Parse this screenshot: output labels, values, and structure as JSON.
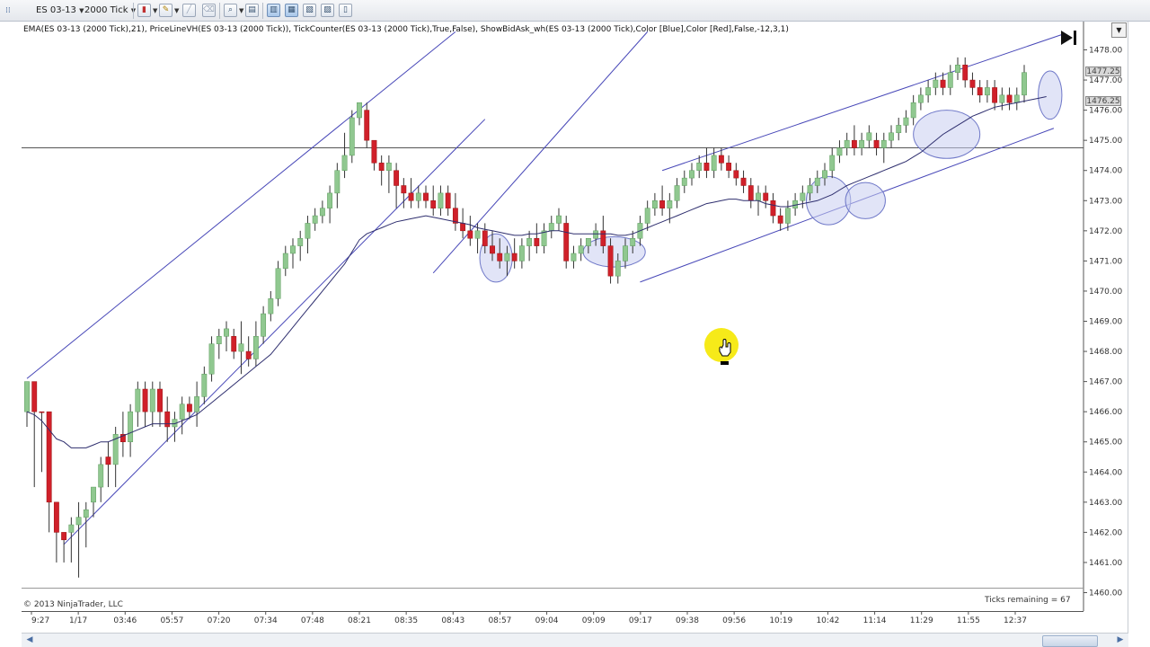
{
  "toolbar": {
    "instrument": "ES 03-13",
    "period": "2000 Tick",
    "icons": [
      "candlestick-icon",
      "pencil-icon",
      "drawing-icon",
      "zoom-icon",
      "properties-icon",
      "bar-spacing-icon",
      "data-box-icon",
      "chart-trader-icon",
      "strategy-icon",
      "dom-icon"
    ]
  },
  "indicator_text": "EMA(ES 03-13 (2000 Tick),21), PriceLineVH(ES 03-13 (2000 Tick)), TickCounter(ES 03-13 (2000 Tick),True,False), ShowBidAsk_wh(ES 03-13 (2000 Tick),Color [Blue],Color [Red],False,-12,3,1)",
  "copyright": "© 2013 NinjaTrader, LLC",
  "ticks_remaining": "Ticks remaining = 67",
  "colors": {
    "up": "#90c890",
    "down": "#d0202a",
    "wick": "#333333",
    "ema": "#2e2e6e",
    "trendline": "#4848b8",
    "ellipse_fill": "#c8cdf0",
    "ellipse_stroke": "#6f78c8",
    "cursor_highlight": "#f5e800"
  },
  "chart_data": {
    "type": "candlestick",
    "y_axis": {
      "min": 1460.0,
      "max": 1478.0,
      "ticks": [
        "1478.00",
        "1477.00",
        "1476.00",
        "1475.00",
        "1474.00",
        "1473.00",
        "1472.00",
        "1471.00",
        "1470.00",
        "1469.00",
        "1468.00",
        "1467.00",
        "1466.00",
        "1465.00",
        "1464.00",
        "1463.00",
        "1462.00",
        "1461.00",
        "1460.00"
      ]
    },
    "x_labels": [
      "9:27",
      "1/17",
      "03:46",
      "05:57",
      "07:20",
      "07:34",
      "07:48",
      "08:21",
      "08:35",
      "08:43",
      "08:57",
      "09:04",
      "09:09",
      "09:17",
      "09:38",
      "09:56",
      "10:19",
      "10:42",
      "11:14",
      "11:29",
      "11:55",
      "12:37"
    ],
    "price_labels": {
      "ask": "1477.25",
      "bid": "1476.25"
    },
    "horizontal_line": 1474.75,
    "candles": [
      [
        1466,
        1467,
        1465.5,
        1467,
        "1"
      ],
      [
        1467,
        1467,
        1463.5,
        1466,
        "0"
      ],
      [
        1466,
        1466,
        1464,
        1466,
        "0"
      ],
      [
        1466,
        1466,
        1462,
        1463,
        "0"
      ],
      [
        1463,
        1463,
        1461,
        1462,
        "0"
      ],
      [
        1462,
        1462,
        1461,
        1461.75,
        "0"
      ],
      [
        1462,
        1462.5,
        1461,
        1462.25,
        "1"
      ],
      [
        1462.25,
        1463,
        1460.5,
        1462.5,
        "1"
      ],
      [
        1462.5,
        1463,
        1461.5,
        1462.75,
        "1"
      ],
      [
        1463,
        1463.5,
        1462.5,
        1463.5,
        "1"
      ],
      [
        1463.5,
        1464.5,
        1463,
        1464.25,
        "1"
      ],
      [
        1464.5,
        1465,
        1463.5,
        1464.25,
        "0"
      ],
      [
        1464.25,
        1465.5,
        1463.5,
        1465.25,
        "1"
      ],
      [
        1465.25,
        1466,
        1464.5,
        1465,
        "0"
      ],
      [
        1465,
        1466.25,
        1464.5,
        1466,
        "1"
      ],
      [
        1466,
        1467,
        1465.5,
        1466.75,
        "1"
      ],
      [
        1466.75,
        1467,
        1465.5,
        1466,
        "0"
      ],
      [
        1466,
        1467,
        1465.5,
        1466.75,
        "1"
      ],
      [
        1466.75,
        1467,
        1465.5,
        1466,
        "0"
      ],
      [
        1466,
        1466.5,
        1465,
        1465.5,
        "0"
      ],
      [
        1465.5,
        1466,
        1465,
        1465.75,
        "1"
      ],
      [
        1465.75,
        1466.5,
        1465.25,
        1466.25,
        "1"
      ],
      [
        1466.25,
        1466.5,
        1465.75,
        1466,
        "0"
      ],
      [
        1466,
        1467,
        1465.5,
        1466.5,
        "1"
      ],
      [
        1466.5,
        1467.5,
        1466.25,
        1467.25,
        "1"
      ],
      [
        1467.25,
        1468.5,
        1467,
        1468.25,
        "1"
      ],
      [
        1468.25,
        1468.75,
        1467.75,
        1468.5,
        "1"
      ],
      [
        1468.5,
        1469,
        1468,
        1468.75,
        "1"
      ],
      [
        1468.5,
        1468.75,
        1467.75,
        1468,
        "0"
      ],
      [
        1468,
        1469,
        1467.25,
        1468.25,
        "1"
      ],
      [
        1468,
        1468.5,
        1467.5,
        1467.75,
        "0"
      ],
      [
        1467.75,
        1469,
        1467.5,
        1468.5,
        "1"
      ],
      [
        1468.5,
        1469.5,
        1468.25,
        1469.25,
        "1"
      ],
      [
        1469.25,
        1470,
        1469,
        1469.75,
        "1"
      ],
      [
        1469.75,
        1471,
        1469.5,
        1470.75,
        "1"
      ],
      [
        1470.75,
        1471.5,
        1470.5,
        1471.25,
        "1"
      ],
      [
        1471.25,
        1471.75,
        1470.75,
        1471.5,
        "1"
      ],
      [
        1471.5,
        1472,
        1471,
        1471.75,
        "1"
      ],
      [
        1471.75,
        1472.5,
        1471.25,
        1472.25,
        "1"
      ],
      [
        1472.25,
        1472.75,
        1472,
        1472.5,
        "1"
      ],
      [
        1472.5,
        1473,
        1472.25,
        1472.75,
        "1"
      ],
      [
        1472.75,
        1473.5,
        1472.25,
        1473.25,
        "1"
      ],
      [
        1473.25,
        1474.25,
        1472.75,
        1474,
        "1"
      ],
      [
        1474,
        1475.25,
        1473.75,
        1474.5,
        "1"
      ],
      [
        1474.5,
        1476,
        1474.25,
        1475.75,
        "1"
      ],
      [
        1475.75,
        1476,
        1475.5,
        1476.25,
        "1"
      ],
      [
        1476,
        1476.25,
        1474.75,
        1475,
        "0"
      ],
      [
        1475,
        1475,
        1474,
        1474.25,
        "0"
      ],
      [
        1474.25,
        1474.5,
        1473.5,
        1474,
        "0"
      ],
      [
        1474,
        1474.5,
        1473.25,
        1474.25,
        "1"
      ],
      [
        1474,
        1474.25,
        1472.75,
        1473.5,
        "0"
      ],
      [
        1473.5,
        1473.75,
        1472.75,
        1473.25,
        "0"
      ],
      [
        1473.25,
        1473.75,
        1472.75,
        1473,
        "0"
      ],
      [
        1473,
        1473.5,
        1472.75,
        1473.25,
        "1"
      ],
      [
        1473.25,
        1473.5,
        1472.75,
        1473,
        "0"
      ],
      [
        1473,
        1473.5,
        1472.5,
        1472.75,
        "0"
      ],
      [
        1472.75,
        1473.5,
        1472.5,
        1473.25,
        "1"
      ],
      [
        1473.25,
        1473.5,
        1472.5,
        1472.75,
        "0"
      ],
      [
        1472.75,
        1473.25,
        1472,
        1472.25,
        "0"
      ],
      [
        1472.25,
        1472.75,
        1471.75,
        1472,
        "0"
      ],
      [
        1472,
        1472.5,
        1471.5,
        1471.75,
        "0"
      ],
      [
        1471.75,
        1472.25,
        1471.25,
        1472,
        "1"
      ],
      [
        1472,
        1472.25,
        1471.25,
        1471.5,
        "0"
      ],
      [
        1471.5,
        1472,
        1471,
        1471.25,
        "0"
      ],
      [
        1471.25,
        1471.75,
        1470.75,
        1471,
        "0"
      ],
      [
        1471,
        1471.5,
        1470.5,
        1471.25,
        "1"
      ],
      [
        1471.25,
        1471.75,
        1470.75,
        1471,
        "0"
      ],
      [
        1471,
        1471.75,
        1470.75,
        1471.5,
        "1"
      ],
      [
        1471.5,
        1472,
        1471,
        1471.75,
        "1"
      ],
      [
        1471.75,
        1472.25,
        1471.25,
        1471.5,
        "0"
      ],
      [
        1471.5,
        1472.25,
        1471.25,
        1472,
        "1"
      ],
      [
        1472,
        1472.5,
        1471.75,
        1472.25,
        "1"
      ],
      [
        1472.25,
        1472.75,
        1472,
        1472.5,
        "1"
      ],
      [
        1472.25,
        1472.5,
        1470.75,
        1471,
        "0"
      ],
      [
        1471,
        1471.5,
        1470.75,
        1471.25,
        "1"
      ],
      [
        1471.25,
        1471.75,
        1471,
        1471.5,
        "1"
      ],
      [
        1471.5,
        1471.75,
        1471.25,
        1471.75,
        "1"
      ],
      [
        1471.75,
        1472.25,
        1471.5,
        1472,
        "1"
      ],
      [
        1472,
        1472.5,
        1471.25,
        1471.5,
        "0"
      ],
      [
        1471.5,
        1471.75,
        1470.25,
        1470.5,
        "0"
      ],
      [
        1470.5,
        1471.25,
        1470.25,
        1471,
        "1"
      ],
      [
        1471,
        1471.75,
        1470.75,
        1471.5,
        "1"
      ],
      [
        1471.5,
        1472,
        1471.25,
        1471.75,
        "1"
      ],
      [
        1471.75,
        1472.5,
        1471.5,
        1472.25,
        "1"
      ],
      [
        1472.25,
        1473,
        1472,
        1472.75,
        "1"
      ],
      [
        1472.75,
        1473.25,
        1472.5,
        1473,
        "1"
      ],
      [
        1473,
        1473.5,
        1472.5,
        1472.75,
        "0"
      ],
      [
        1472.75,
        1473.25,
        1472.25,
        1473,
        "1"
      ],
      [
        1473,
        1473.75,
        1472.75,
        1473.5,
        "1"
      ],
      [
        1473.5,
        1474,
        1473.25,
        1473.75,
        "1"
      ],
      [
        1473.75,
        1474.25,
        1473.5,
        1474,
        "1"
      ],
      [
        1474,
        1474.5,
        1473.75,
        1474.25,
        "1"
      ],
      [
        1474.25,
        1474.75,
        1473.75,
        1474,
        "0"
      ],
      [
        1474,
        1474.75,
        1473.75,
        1474.5,
        "1"
      ],
      [
        1474.5,
        1474.75,
        1474,
        1474.25,
        "0"
      ],
      [
        1474.25,
        1474.5,
        1473.75,
        1474,
        "0"
      ],
      [
        1474,
        1474.25,
        1473.5,
        1473.75,
        "0"
      ],
      [
        1473.75,
        1474,
        1473.25,
        1473.5,
        "0"
      ],
      [
        1473.5,
        1473.75,
        1472.75,
        1473,
        "0"
      ],
      [
        1473,
        1473.5,
        1472.5,
        1473.25,
        "1"
      ],
      [
        1473.25,
        1473.5,
        1472.75,
        1473,
        "0"
      ],
      [
        1473,
        1473.25,
        1472.25,
        1472.5,
        "0"
      ],
      [
        1472.5,
        1472.75,
        1472,
        1472.25,
        "0"
      ],
      [
        1472.25,
        1473,
        1472,
        1472.75,
        "1"
      ],
      [
        1472.75,
        1473.25,
        1472.5,
        1473,
        "1"
      ],
      [
        1473,
        1473.5,
        1472.75,
        1473.25,
        "1"
      ],
      [
        1473.25,
        1473.75,
        1473,
        1473.5,
        "1"
      ],
      [
        1473.5,
        1474,
        1473.25,
        1473.75,
        "1"
      ],
      [
        1473.75,
        1474.25,
        1473.5,
        1474,
        "1"
      ],
      [
        1474,
        1474.75,
        1473.75,
        1474.5,
        "1"
      ],
      [
        1474.5,
        1475,
        1474.25,
        1474.75,
        "1"
      ],
      [
        1474.75,
        1475.25,
        1474.5,
        1475,
        "1"
      ],
      [
        1475,
        1475.5,
        1474.5,
        1474.75,
        "0"
      ],
      [
        1474.75,
        1475.25,
        1474.5,
        1475,
        "1"
      ],
      [
        1475,
        1475.5,
        1474.75,
        1475.25,
        "1"
      ],
      [
        1475,
        1475.25,
        1474.5,
        1474.75,
        "0"
      ],
      [
        1474.75,
        1475.25,
        1474.25,
        1475,
        "1"
      ],
      [
        1475,
        1475.5,
        1474.75,
        1475.25,
        "1"
      ],
      [
        1475.25,
        1475.75,
        1475,
        1475.5,
        "1"
      ],
      [
        1475.5,
        1476,
        1475.25,
        1475.75,
        "1"
      ],
      [
        1475.75,
        1476.5,
        1475.5,
        1476.25,
        "1"
      ],
      [
        1476.25,
        1476.75,
        1476,
        1476.5,
        "1"
      ],
      [
        1476.5,
        1477,
        1476.25,
        1476.75,
        "1"
      ],
      [
        1476.75,
        1477.25,
        1476.5,
        1477,
        "1"
      ],
      [
        1477,
        1477.25,
        1476.5,
        1476.75,
        "0"
      ],
      [
        1476.75,
        1477.5,
        1476.5,
        1477.25,
        "1"
      ],
      [
        1477.25,
        1477.75,
        1477,
        1477.5,
        "1"
      ],
      [
        1477.5,
        1477.75,
        1476.75,
        1477,
        "0"
      ],
      [
        1477,
        1477.25,
        1476.5,
        1476.75,
        "0"
      ],
      [
        1476.75,
        1477,
        1476.25,
        1476.5,
        "0"
      ],
      [
        1476.5,
        1477,
        1476.25,
        1476.75,
        "1"
      ],
      [
        1476.75,
        1477,
        1476,
        1476.25,
        "0"
      ],
      [
        1476.25,
        1476.75,
        1476,
        1476.5,
        "1"
      ],
      [
        1476.5,
        1476.75,
        1476,
        1476.25,
        "0"
      ],
      [
        1476.25,
        1476.75,
        1476,
        1476.5,
        "1"
      ],
      [
        1476.5,
        1477.5,
        1476.25,
        1477.25,
        "1"
      ]
    ],
    "ema_21": [
      1466.0,
      1465.9,
      1465.7,
      1465.4,
      1465.1,
      1465.0,
      1464.8,
      1464.8,
      1464.8,
      1464.9,
      1465.0,
      1465.0,
      1465.1,
      1465.2,
      1465.3,
      1465.4,
      1465.5,
      1465.6,
      1465.6,
      1465.6,
      1465.6,
      1465.7,
      1465.8,
      1465.9,
      1466.1,
      1466.3,
      1466.5,
      1466.7,
      1466.9,
      1467.1,
      1467.3,
      1467.5,
      1467.7,
      1467.9,
      1468.2,
      1468.5,
      1468.8,
      1469.1,
      1469.4,
      1469.7,
      1470.0,
      1470.3,
      1470.6,
      1470.9,
      1471.3,
      1471.7,
      1471.9,
      1472.0,
      1472.1,
      1472.2,
      1472.3,
      1472.35,
      1472.4,
      1472.45,
      1472.5,
      1472.45,
      1472.4,
      1472.35,
      1472.3,
      1472.25,
      1472.2,
      1472.1,
      1472.05,
      1472.0,
      1471.95,
      1471.9,
      1471.85,
      1471.85,
      1471.9,
      1471.9,
      1471.95,
      1472.0,
      1472.0,
      1471.95,
      1471.9,
      1471.9,
      1471.9,
      1471.9,
      1471.9,
      1471.9,
      1471.85,
      1471.85,
      1471.9,
      1472.0,
      1472.1,
      1472.2,
      1472.3,
      1472.4,
      1472.5,
      1472.6,
      1472.7,
      1472.8,
      1472.9,
      1472.95,
      1473.0,
      1473.05,
      1473.05,
      1473.0,
      1473.0,
      1473.0,
      1472.9,
      1472.85,
      1472.8,
      1472.8,
      1472.85,
      1472.9,
      1472.95,
      1473.0,
      1473.1,
      1473.2,
      1473.35,
      1473.5,
      1473.6,
      1473.7,
      1473.8,
      1473.9,
      1474.0,
      1474.1,
      1474.2,
      1474.3,
      1474.45,
      1474.6,
      1474.8,
      1475.0,
      1475.2,
      1475.35,
      1475.5,
      1475.65,
      1475.8,
      1475.9,
      1476.0,
      1476.1,
      1476.15,
      1476.2,
      1476.25,
      1476.3,
      1476.35,
      1476.4,
      1476.45
    ]
  }
}
